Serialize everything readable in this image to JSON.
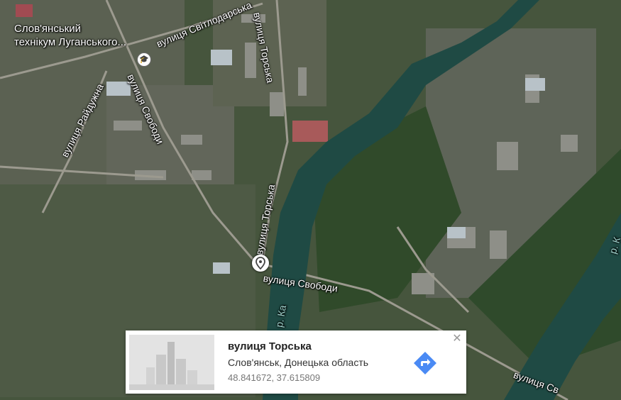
{
  "map": {
    "poi": {
      "name_line1": "Слов'янський",
      "name_line2": "технікум Луганського...",
      "icon": "school-icon"
    },
    "streets": {
      "svitlodarska": "вулиця Світлодарська",
      "torska_top": "вулиця Торська",
      "raidyuzhna": "вулиця Райдужна",
      "svobody_left": "вулиця Свободи",
      "torska_mid": "вулиця Торська",
      "svobody_mid": "вулиця Свободи",
      "river_kazennyi": "р. Ка",
      "svobody_right": "вулиця Св",
      "river_right": "р. К"
    },
    "pin_icon": "location-pin-icon"
  },
  "card": {
    "title": "вулиця Торська",
    "address": "Слов'янськ, Донецька область",
    "coordinates": "48.841672, 37.615809",
    "directions_icon": "directions-icon",
    "close_icon": "close-icon",
    "close_label": "✕"
  },
  "colors": {
    "water": "#1f4a44",
    "accent": "#4a8af4"
  }
}
